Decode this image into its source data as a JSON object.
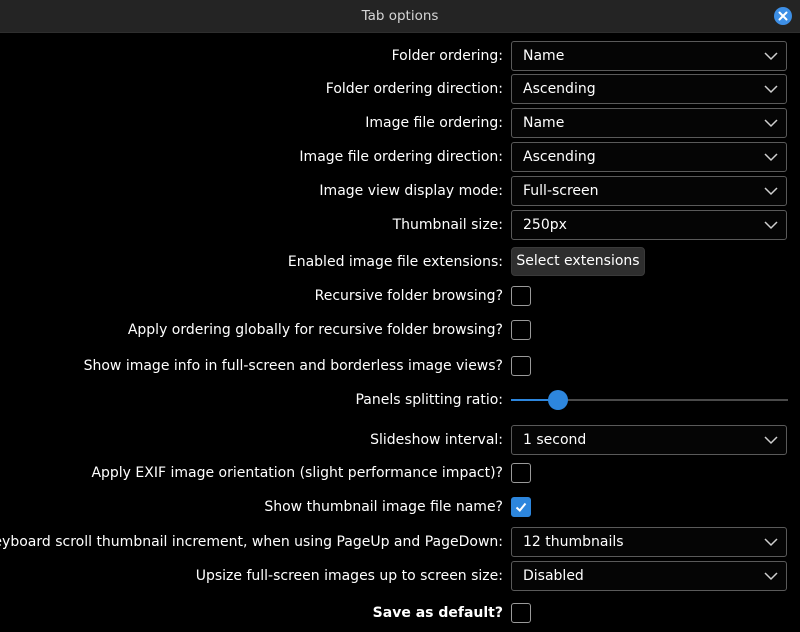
{
  "dialog": {
    "title": "Tab options",
    "close_icon": "close-icon",
    "accent": "#2d86dd"
  },
  "settings": {
    "folder_ordering": {
      "label": "Folder ordering:",
      "value": "Name"
    },
    "folder_direction": {
      "label": "Folder ordering direction:",
      "value": "Ascending"
    },
    "image_ordering": {
      "label": "Image file ordering:",
      "value": "Name"
    },
    "image_direction": {
      "label": "Image file ordering direction:",
      "value": "Ascending"
    },
    "display_mode": {
      "label": "Image view display mode:",
      "value": "Full-screen"
    },
    "thumbnail_size": {
      "label": "Thumbnail size:",
      "value": "250px"
    },
    "extensions": {
      "label": "Enabled image file extensions:",
      "button": "Select extensions"
    },
    "recursive": {
      "label": "Recursive folder browsing?",
      "checked": false
    },
    "global_ordering": {
      "label": "Apply ordering globally for recursive folder browsing?",
      "checked": false
    },
    "show_info": {
      "label": "Show image info in full-screen and borderless image views?",
      "checked": false
    },
    "split_ratio": {
      "label": "Panels splitting ratio:",
      "value": 0.17
    },
    "slideshow": {
      "label": "Slideshow interval:",
      "value": "1 second"
    },
    "exif": {
      "label": "Apply EXIF image orientation (slight performance impact)?",
      "checked": false
    },
    "thumb_name": {
      "label": "Show thumbnail image file name?",
      "checked": true
    },
    "scroll_increment": {
      "label": "Keyboard scroll thumbnail increment, when using PageUp and PageDown:",
      "value": "12 thumbnails"
    },
    "upsize": {
      "label": "Upsize full-screen images up to screen size:",
      "value": "Disabled"
    },
    "save_default": {
      "label": "Save as default?",
      "checked": false
    }
  }
}
